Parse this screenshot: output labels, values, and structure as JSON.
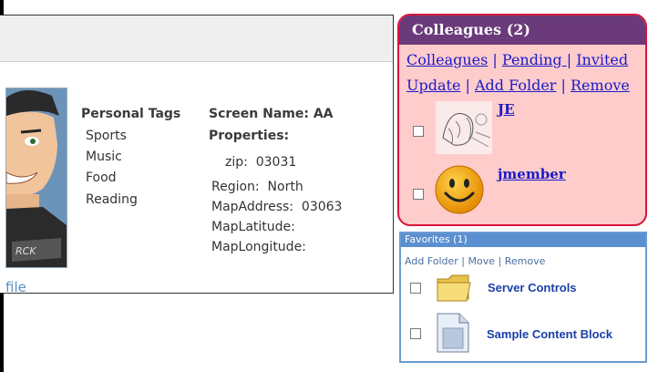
{
  "profile": {
    "link_fragment": "file",
    "personal_tags": {
      "title": "Personal Tags",
      "items": [
        "Sports",
        "Music",
        "Food",
        "Reading"
      ]
    },
    "screen_name": "Screen Name: AA",
    "properties_title": "Properties:",
    "properties": [
      {
        "text": "zip:  03031"
      },
      {
        "text": "Region:  North"
      },
      {
        "text": "MapAddress:  03063"
      },
      {
        "text": "MapLatitude:"
      },
      {
        "text": "MapLongitude:"
      }
    ]
  },
  "colleagues": {
    "title": "Colleagues (2)",
    "links_row1": [
      "Colleagues",
      "Pending ",
      "Invited"
    ],
    "links_row2": [
      "Update",
      "Add Folder",
      "Remove"
    ],
    "members": [
      {
        "name": "JE"
      },
      {
        "name": "jmember"
      }
    ]
  },
  "favorites": {
    "title": "Favorites (1)",
    "actions": [
      "Add Folder",
      "Move",
      "Remove"
    ],
    "items": [
      {
        "label": "Server Controls",
        "icon": "folder-icon"
      },
      {
        "label": "Sample Content Block",
        "icon": "document-icon"
      }
    ]
  }
}
